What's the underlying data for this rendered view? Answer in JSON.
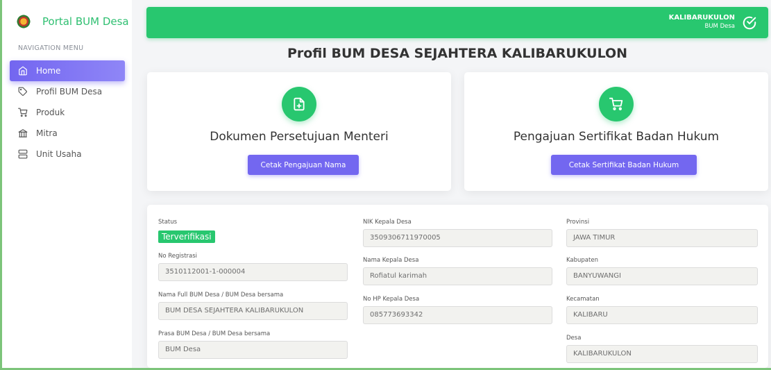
{
  "brand": {
    "name": "Portal BUM Desa",
    "logo_icon": "village-emblem-icon"
  },
  "sidebar": {
    "caption": "NAVIGATION MENU",
    "items": [
      {
        "label": "Home",
        "icon": "home-icon",
        "active": true
      },
      {
        "label": "Profil BUM Desa",
        "icon": "tag-icon",
        "active": false
      },
      {
        "label": "Produk",
        "icon": "cart-icon",
        "active": false
      },
      {
        "label": "Mitra",
        "icon": "columns-icon",
        "active": false
      },
      {
        "label": "Unit Usaha",
        "icon": "server-icon",
        "active": false
      }
    ]
  },
  "header": {
    "user_name": "KALIBARUKULON",
    "user_role": "BUM Desa",
    "user_icon": "check-circle-icon",
    "bar_color": "#28c76f"
  },
  "page": {
    "title": "Profil BUM DESA SEJAHTERA KALIBARUKULON"
  },
  "cards": {
    "document": {
      "icon": "file-plus-icon",
      "title": "Dokumen Persetujuan Menteri",
      "button": "Cetak Pengajuan Nama"
    },
    "certificate": {
      "icon": "cart-icon",
      "title": "Pengajuan Sertifikat Badan Hukum",
      "button": "Cetak Sertifikat Badan Hukum"
    }
  },
  "profile": {
    "status": {
      "label": "Status",
      "value": "Terverifikasi"
    },
    "no_registrasi": {
      "label": "No Registrasi",
      "value": "3510112001-1-000004"
    },
    "nama_full": {
      "label": "Nama Full BUM Desa / BUM Desa bersama",
      "value": "BUM DESA SEJAHTERA KALIBARUKULON"
    },
    "prasa": {
      "label": "Prasa BUM Desa / BUM Desa bersama",
      "value": "BUM Desa"
    },
    "nik_kepala": {
      "label": "NIK Kepala Desa",
      "value": "3509306711970005"
    },
    "nama_kepala": {
      "label": "Nama Kepala Desa",
      "value": "Rofiatul karimah"
    },
    "hp_kepala": {
      "label": "No HP Kepala Desa",
      "value": "085773693342"
    },
    "provinsi": {
      "label": "Provinsi",
      "value": "JAWA TIMUR"
    },
    "kabupaten": {
      "label": "Kabupaten",
      "value": "BANYUWANGI"
    },
    "kecamatan": {
      "label": "Kecamatan",
      "value": "KALIBARU"
    },
    "desa": {
      "label": "Desa",
      "value": "KALIBARUKULON"
    }
  },
  "colors": {
    "accent": "#7367f0",
    "success": "#28c76f",
    "brand_text": "#2fbf71"
  }
}
